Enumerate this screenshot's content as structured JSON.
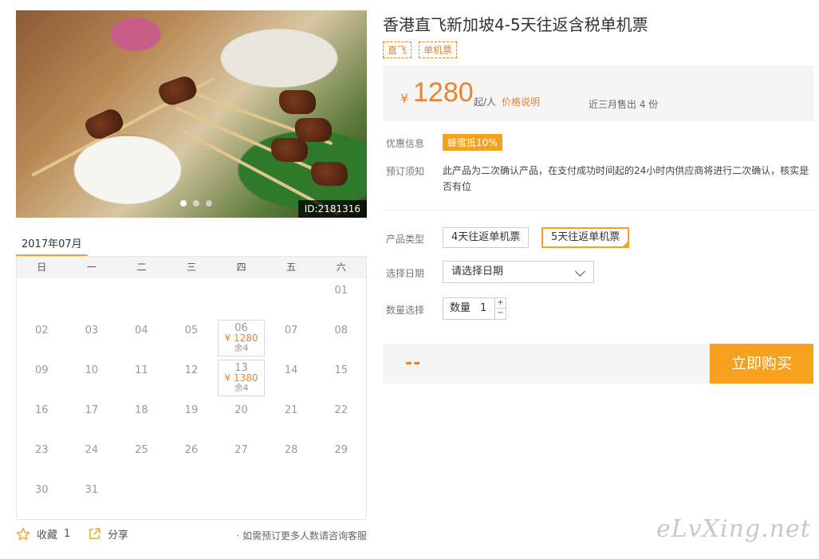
{
  "hero": {
    "image_id": "ID:2181316",
    "slides": 3
  },
  "calendar": {
    "month_label": "2017年07月",
    "weekdays": [
      "日",
      "一",
      "二",
      "三",
      "四",
      "五",
      "六"
    ],
    "leading_blanks": 6,
    "days": [
      "01",
      "02",
      "03",
      "04",
      "05",
      "06",
      "07",
      "08",
      "09",
      "10",
      "11",
      "12",
      "13",
      "14",
      "15",
      "16",
      "17",
      "18",
      "19",
      "20",
      "21",
      "22",
      "23",
      "24",
      "25",
      "26",
      "27",
      "28",
      "29",
      "30",
      "31"
    ],
    "prices": {
      "06": {
        "price": "¥ 1280",
        "remain": "余4"
      },
      "13": {
        "price": "¥ 1380",
        "remain": "余4"
      }
    }
  },
  "footer": {
    "fav_label": "收藏",
    "fav_count": "1",
    "share_label": "分享",
    "note": "· 如需预订更多人数请咨询客服"
  },
  "product": {
    "title": "香港直飞新加坡4-5天往返含税单机票",
    "tags": [
      "直飞",
      "单机票"
    ],
    "currency": "¥",
    "price": "1280",
    "per": "起/人",
    "price_explain": "价格说明",
    "sold": "近三月售出 4 份"
  },
  "info": {
    "promo_label": "优惠信息",
    "promo_badge": "蜂蜜抵10%",
    "notice_label": "预订须知",
    "notice_text": "此产品为二次确认产品，在支付成功时间起的24小时内供应商将进行二次确认，核实是否有位"
  },
  "options": {
    "type_label": "产品类型",
    "types": [
      "4天往返单机票",
      "5天往返单机票"
    ],
    "selected_type": 1,
    "date_label": "选择日期",
    "date_placeholder": "请选择日期",
    "qty_label": "数量选择",
    "qty_inner_label": "数量",
    "qty_value": "1",
    "qty_plus": "+",
    "qty_minus": "−"
  },
  "buy": {
    "total": "--",
    "button": "立即购买"
  },
  "watermark": "eLvXing.net",
  "colors": {
    "accent": "#f5a11e",
    "price": "#e8842c"
  }
}
